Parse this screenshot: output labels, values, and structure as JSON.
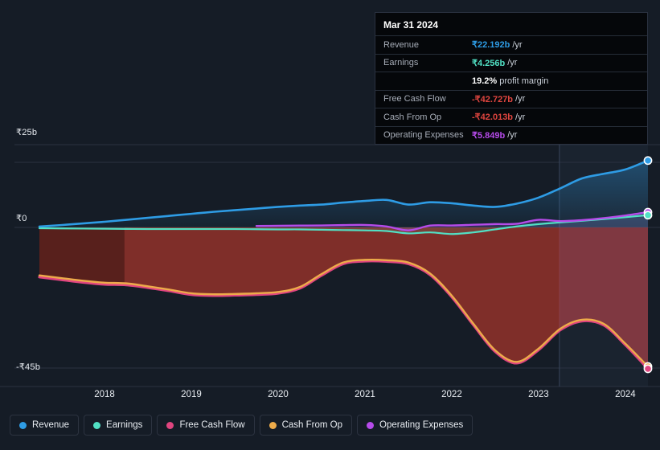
{
  "background_color": "#151c26",
  "tooltip": {
    "title": "Mar 31 2024",
    "rows": [
      {
        "label": "Revenue",
        "value": "₹22.192b",
        "unit": "/yr",
        "color": "#2e9ce5"
      },
      {
        "label": "Earnings",
        "value": "₹4.256b",
        "unit": "/yr",
        "color": "#51e0c4"
      },
      {
        "label": "",
        "value": "19.2%",
        "unit": "profit margin",
        "color": "#ffffff",
        "sub": true
      },
      {
        "label": "Free Cash Flow",
        "value": "-₹42.727b",
        "unit": "/yr",
        "color": "#e0453f"
      },
      {
        "label": "Cash From Op",
        "value": "-₹42.013b",
        "unit": "/yr",
        "color": "#e0453f"
      },
      {
        "label": "Operating Expenses",
        "value": "₹5.849b",
        "unit": "/yr",
        "color": "#b64bea"
      }
    ]
  },
  "legend": {
    "items": [
      {
        "label": "Revenue",
        "color": "#2e9ce5"
      },
      {
        "label": "Earnings",
        "color": "#51e0c4"
      },
      {
        "label": "Free Cash Flow",
        "color": "#e0457f"
      },
      {
        "label": "Cash From Op",
        "color": "#edab4a"
      },
      {
        "label": "Operating Expenses",
        "color": "#b64bea"
      }
    ]
  },
  "chart_data": {
    "type": "area",
    "title": "",
    "xlabel": "",
    "ylabel": "",
    "currency": "INR",
    "unit": "b",
    "grid": true,
    "legend_position": "bottom-left",
    "ylim": [
      -45,
      25
    ],
    "y_ticks": [
      {
        "label": "₹25b",
        "value": 25
      },
      {
        "label": "₹0",
        "value": 0
      },
      {
        "label": "-₹45b",
        "value": -45
      }
    ],
    "x_ticks": [
      {
        "label": "2018",
        "value": 2018
      },
      {
        "label": "2019",
        "value": 2019
      },
      {
        "label": "2020",
        "value": 2020
      },
      {
        "label": "2021",
        "value": 2021
      },
      {
        "label": "2022",
        "value": 2022
      },
      {
        "label": "2023",
        "value": 2023
      },
      {
        "label": "2024",
        "value": 2024
      }
    ],
    "x_range": [
      2017.25,
      2024.26
    ],
    "forecast_start": 2023.24,
    "past_shade_end": 2018.23,
    "series": [
      {
        "name": "Revenue",
        "color": "#2e9ce5",
        "x": [
          2017.25,
          2017.5,
          2017.75,
          2018.0,
          2018.25,
          2018.5,
          2018.75,
          2019.0,
          2019.25,
          2019.5,
          2019.75,
          2020.0,
          2020.25,
          2020.5,
          2020.75,
          2021.0,
          2021.25,
          2021.5,
          2021.75,
          2022.0,
          2022.25,
          2022.5,
          2022.75,
          2023.0,
          2023.25,
          2023.5,
          2023.75,
          2024.0,
          2024.26
        ],
        "values": [
          0.25,
          0.7,
          1.2,
          1.7,
          2.3,
          2.9,
          3.5,
          4.1,
          4.7,
          5.2,
          5.7,
          6.2,
          6.6,
          6.9,
          7.5,
          8.0,
          8.3,
          6.9,
          7.6,
          7.3,
          6.6,
          6.2,
          7.2,
          9.0,
          11.8,
          14.8,
          16.2,
          17.5,
          20.2
        ]
      },
      {
        "name": "Earnings",
        "color": "#51e0c4",
        "x": [
          2017.25,
          2017.5,
          2017.75,
          2018.0,
          2018.25,
          2018.5,
          2018.75,
          2019.0,
          2019.25,
          2019.5,
          2019.75,
          2020.0,
          2020.25,
          2020.5,
          2020.75,
          2021.0,
          2021.25,
          2021.5,
          2021.75,
          2022.0,
          2022.25,
          2022.5,
          2022.75,
          2023.0,
          2023.25,
          2023.5,
          2023.75,
          2024.0,
          2024.26
        ],
        "values": [
          -0.25,
          -0.3,
          -0.35,
          -0.4,
          -0.45,
          -0.5,
          -0.5,
          -0.5,
          -0.5,
          -0.5,
          -0.55,
          -0.6,
          -0.6,
          -0.7,
          -0.8,
          -0.9,
          -1.1,
          -1.8,
          -1.5,
          -2.0,
          -1.5,
          -0.6,
          0.3,
          1.0,
          1.5,
          2.0,
          2.5,
          3.1,
          3.7
        ]
      },
      {
        "name": "Free Cash Flow",
        "color": "#e0457f",
        "x": [
          2017.25,
          2017.5,
          2017.75,
          2018.0,
          2018.25,
          2018.5,
          2018.75,
          2019.0,
          2019.25,
          2019.5,
          2019.75,
          2020.0,
          2020.25,
          2020.5,
          2020.75,
          2021.0,
          2021.25,
          2021.5,
          2021.75,
          2022.0,
          2022.25,
          2022.5,
          2022.75,
          2023.0,
          2023.25,
          2023.5,
          2023.75,
          2024.0,
          2024.26
        ],
        "values": [
          -15.0,
          -15.8,
          -16.6,
          -17.2,
          -17.4,
          -18.2,
          -19.2,
          -20.3,
          -20.6,
          -20.5,
          -20.3,
          -19.9,
          -18.4,
          -14.5,
          -11.0,
          -10.2,
          -10.3,
          -11.0,
          -14.3,
          -21.0,
          -29.5,
          -37.5,
          -41.0,
          -37.0,
          -31.0,
          -28.3,
          -29.5,
          -35.5,
          -42.7
        ]
      },
      {
        "name": "Cash From Op",
        "color": "#edab4a",
        "x": [
          2017.25,
          2017.5,
          2017.75,
          2018.0,
          2018.25,
          2018.5,
          2018.75,
          2019.0,
          2019.25,
          2019.5,
          2019.75,
          2020.0,
          2020.25,
          2020.5,
          2020.75,
          2021.0,
          2021.25,
          2021.5,
          2021.75,
          2022.0,
          2022.25,
          2022.5,
          2022.75,
          2023.0,
          2023.25,
          2023.5,
          2023.75,
          2024.0,
          2024.26
        ],
        "values": [
          -14.5,
          -15.3,
          -16.1,
          -16.7,
          -16.9,
          -17.8,
          -18.8,
          -19.9,
          -20.2,
          -20.1,
          -19.9,
          -19.5,
          -18.0,
          -14.1,
          -10.6,
          -9.8,
          -9.9,
          -10.6,
          -13.9,
          -20.6,
          -29.1,
          -37.1,
          -40.6,
          -36.6,
          -30.6,
          -27.9,
          -29.1,
          -35.1,
          -42.0
        ]
      },
      {
        "name": "Operating Expenses",
        "color": "#b64bea",
        "x": [
          2019.75,
          2020.0,
          2020.25,
          2020.5,
          2020.75,
          2021.0,
          2021.25,
          2021.5,
          2021.75,
          2022.0,
          2022.25,
          2022.5,
          2022.75,
          2023.0,
          2023.25,
          2023.5,
          2023.75,
          2024.0,
          2024.26
        ],
        "values": [
          0.45,
          0.5,
          0.55,
          0.6,
          0.7,
          0.75,
          0.3,
          -0.9,
          0.55,
          0.6,
          0.8,
          1.0,
          1.1,
          2.3,
          1.9,
          2.2,
          2.8,
          3.6,
          4.6
        ]
      }
    ]
  }
}
